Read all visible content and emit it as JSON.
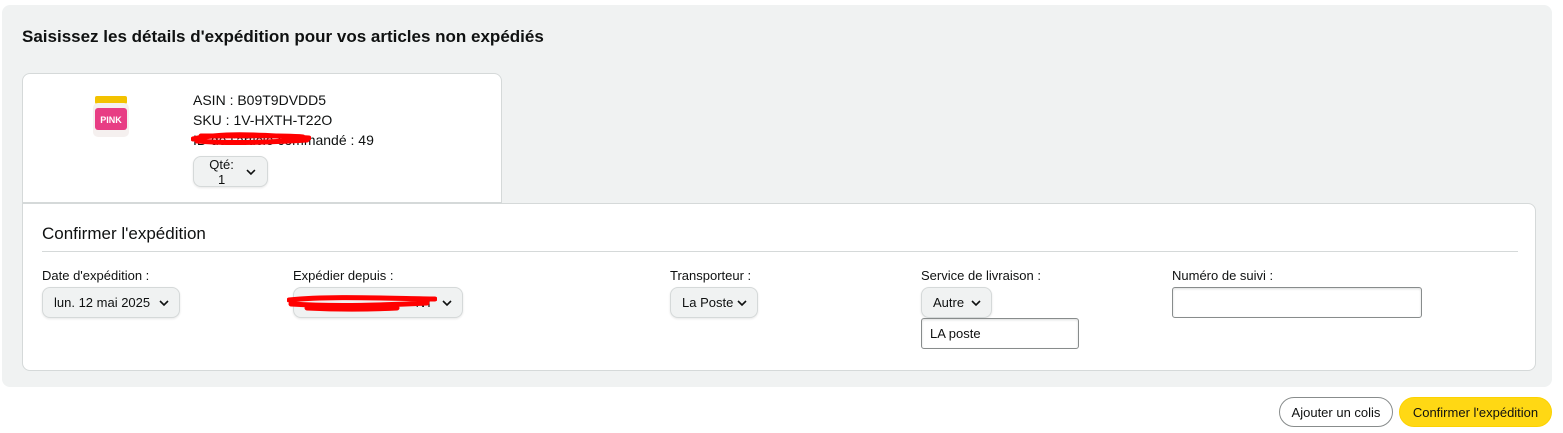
{
  "page": {
    "title": "Saisissez les détails d'expédition pour vos articles non expédiés"
  },
  "item": {
    "asin_line": "ASIN : B09T9DVDD5",
    "sku_line": "SKU : 1V-HXTH-T22O",
    "order_item_line": "ID de l'article commandé : 49",
    "quantity_label": "Qté: 1",
    "product_image_text": "PINK"
  },
  "confirm": {
    "title": "Confirmer l'expédition",
    "ship_date": {
      "label": "Date d'expédition :",
      "value": "lun. 12 mai 2025"
    },
    "ship_from": {
      "label": "Expédier depuis :",
      "value": "NT"
    },
    "carrier": {
      "label": "Transporteur :",
      "value": "La Poste"
    },
    "service": {
      "label": "Service de livraison :",
      "value": "Autre",
      "other_value": "LA poste"
    },
    "tracking": {
      "label": "Numéro de suivi :",
      "value": ""
    }
  },
  "actions": {
    "add_package": "Ajouter un colis",
    "confirm_shipment": "Confirmer l'expédition"
  },
  "colors": {
    "primary_button": "#ffd814",
    "panel_bg": "#f0f2f2",
    "redaction": "#ff0000"
  },
  "icons": [
    "chevron-down-icon",
    "product-image",
    "redaction-mark"
  ]
}
